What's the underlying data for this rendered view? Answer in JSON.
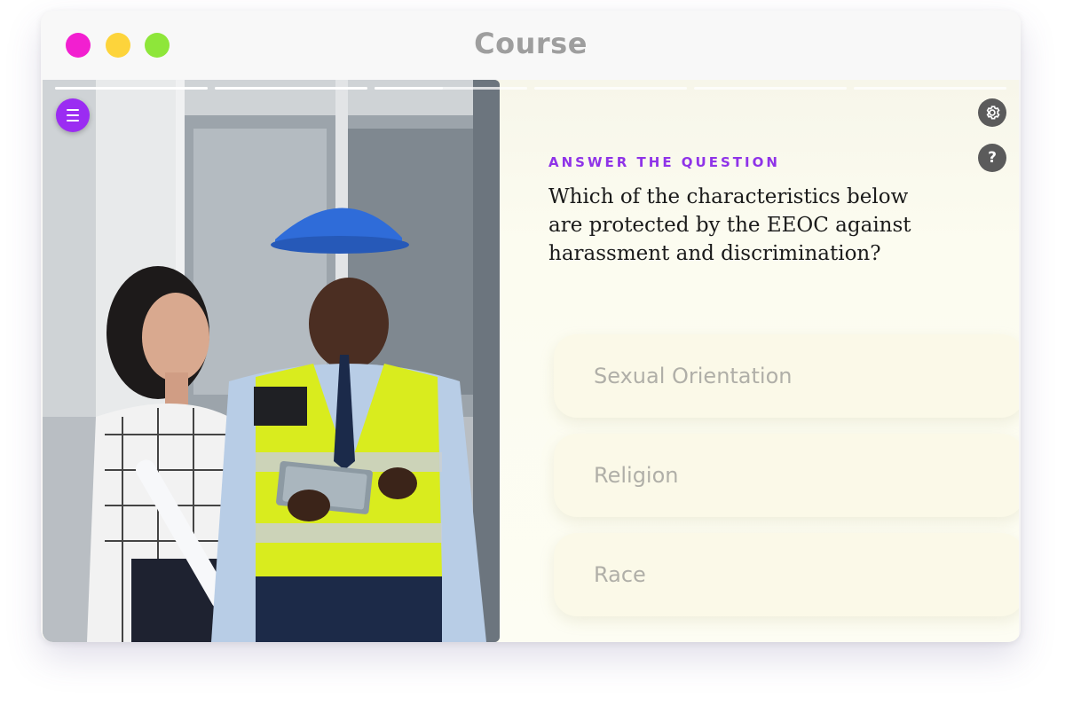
{
  "window": {
    "title": "Course",
    "traffic_lights": [
      "#f21fd0",
      "#fdd43b",
      "#8ee63a"
    ]
  },
  "progress": {
    "segments": [
      1,
      1,
      0.45,
      0,
      0,
      0
    ]
  },
  "toolbar": {
    "menu_icon": "menu-icon",
    "settings_icon": "gear-icon",
    "help_label": "?"
  },
  "question": {
    "eyebrow": "ANSWER THE QUESTION",
    "text": "Which of the characteristics below are protected by the EEOC against harassment and discrimination?"
  },
  "answers": [
    {
      "label": "Sexual Orientation"
    },
    {
      "label": "Religion"
    },
    {
      "label": "Race"
    }
  ],
  "colors": {
    "accent": "#9b2cf2",
    "eyebrow": "#8f33e8",
    "answer_bg": "#fbf9e8",
    "answer_text": "#b0afa8"
  }
}
